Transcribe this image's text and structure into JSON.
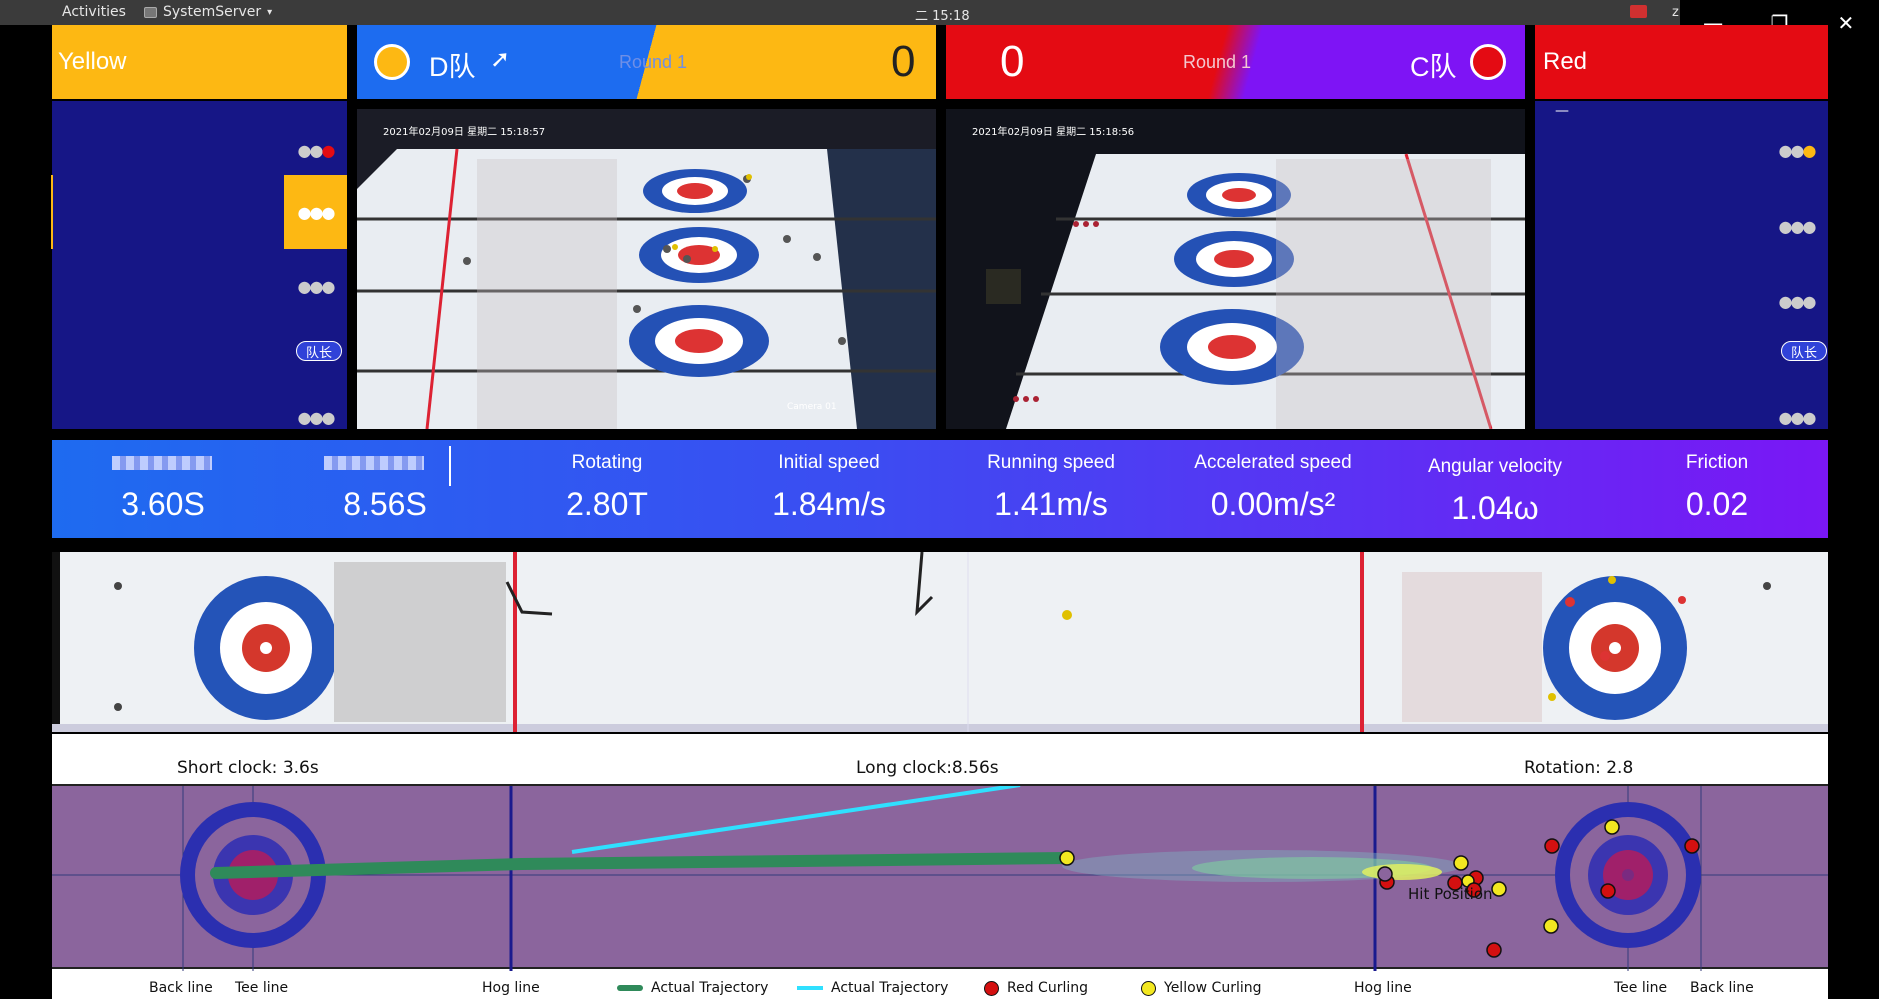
{
  "system_bar": {
    "activities": "Activities",
    "app_name": "SystemServer",
    "clock": "二 15:18",
    "extra": "z"
  },
  "scoreboard": {
    "left_label": "Yellow",
    "team_d": {
      "name": "D队",
      "round": "Round 1",
      "score": "0",
      "stone_color": "#fdb813"
    },
    "team_c": {
      "name": "C队",
      "round": "Round 1",
      "score": "0",
      "stone_color": "#e40b13"
    },
    "right_label": "Red"
  },
  "player_panels": {
    "left": {
      "captain_badge": "队长",
      "active_slot": 1
    },
    "right": {
      "captain_badge": "队长",
      "marker": "—"
    }
  },
  "cameras": [
    {
      "timestamp": "2021年02月09日  星期二  15:18:57",
      "caption": "Camera 01"
    },
    {
      "timestamp": "2021年02月09日  星期二  15:18:56"
    }
  ],
  "stats": [
    {
      "label": "",
      "value": "3.60S"
    },
    {
      "label": "",
      "value": "8.56S"
    },
    {
      "label": "Rotating",
      "value": "2.80T"
    },
    {
      "label": "Initial speed",
      "value": "1.84m/s"
    },
    {
      "label": "Running speed",
      "value": "1.41m/s"
    },
    {
      "label": "Accelerated speed",
      "value": "0.00m/s²"
    },
    {
      "label": "Angular velocity",
      "value": "1.04ω"
    },
    {
      "label": "Friction",
      "value": "0.02"
    }
  ],
  "plot": {
    "short_clock": "Short clock:  3.6s",
    "long_clock": "Long clock:8.56s",
    "rotation": "Rotation:  2.8",
    "hit_position": "Hit Position",
    "bottom_labels": {
      "back_line_left": "Back line",
      "tee_line_left": "Tee line",
      "hog_line_left": "Hog line",
      "legend_actual_green": "Actual Trajectory",
      "legend_actual_cyan": "Actual Trajectory",
      "legend_red": "Red Curling",
      "legend_yellow": "Yellow Curling",
      "hog_line_right": "Hog line",
      "tee_line_right": "Tee line",
      "back_line_right": "Back line"
    }
  },
  "colors": {
    "yellow": "#fdb813",
    "blue": "#1d6cf0",
    "red": "#e40b13",
    "purple": "#7e14f5",
    "panel": "#161686",
    "sheet": "#8b659d"
  }
}
